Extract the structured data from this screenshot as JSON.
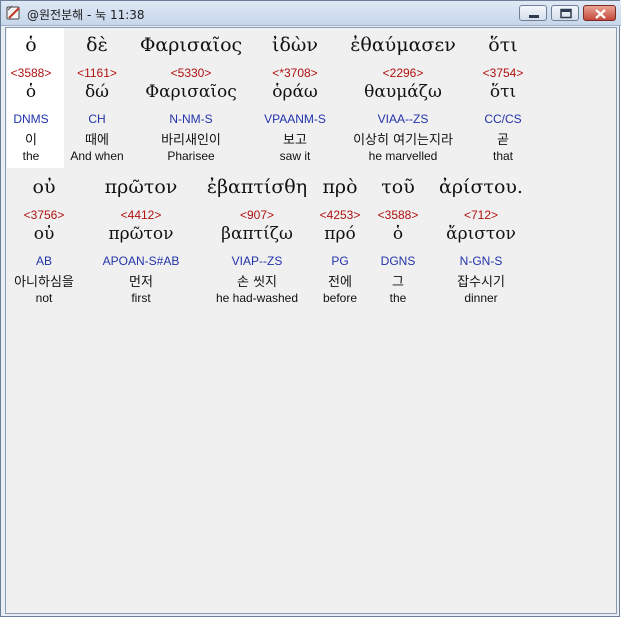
{
  "window": {
    "title": "@원전분해 - 눅 11:38"
  },
  "rows": [
    {
      "words": [
        {
          "greek": "ὁ",
          "strong": "<3588>",
          "lemma": "ὁ",
          "morph": "DNMS",
          "korean": "이",
          "english": "the"
        },
        {
          "greek": "δὲ",
          "strong": "<1161>",
          "lemma": "δώ",
          "morph": "CH",
          "korean": "때에",
          "english": "And when"
        },
        {
          "greek": "Φαρισαῖος",
          "strong": "<5330>",
          "lemma": "Φαρισαῖος",
          "morph": "N-NM-S",
          "korean": "바리새인이",
          "english": "Pharisee"
        },
        {
          "greek": "ἰδὼν",
          "strong": "<*3708>",
          "lemma": "ὁράω",
          "morph": "VPAANM-S",
          "korean": "보고",
          "english": "saw it"
        },
        {
          "greek": "ἐθαύμασεν",
          "strong": "<2296>",
          "lemma": "θαυμάζω",
          "morph": "VIAA--ZS",
          "korean": "이상히 여기는지라",
          "english": "he marvelled"
        },
        {
          "greek": "ὅτι",
          "strong": "<3754>",
          "lemma": "ὅτι",
          "morph": "CC/CS",
          "korean": "곧",
          "english": "that"
        }
      ]
    },
    {
      "words": [
        {
          "greek": "οὐ",
          "strong": "<3756>",
          "lemma": "οὐ",
          "morph": "AB",
          "korean": "아니하심을",
          "english": "not"
        },
        {
          "greek": "πρῶτον",
          "strong": "<4412>",
          "lemma": "πρῶτον",
          "morph": "APOAN-S#AB",
          "korean": "먼저",
          "english": "first"
        },
        {
          "greek": "ἐβαπτίσθη",
          "strong": "<907>",
          "lemma": "βαπτίζω",
          "morph": "VIAP--ZS",
          "korean": "손 씻지",
          "english": "he had-washed"
        },
        {
          "greek": "πρὸ",
          "strong": "<4253>",
          "lemma": "πρό",
          "morph": "PG",
          "korean": "전에",
          "english": "before"
        },
        {
          "greek": "τοῦ",
          "strong": "<3588>",
          "lemma": "ὁ",
          "morph": "DGNS",
          "korean": "그",
          "english": "the"
        },
        {
          "greek": "ἀρίστου.",
          "strong": "<712>",
          "lemma": "ἄριστον",
          "morph": "N-GN-S",
          "korean": "잡수시기",
          "english": "dinner"
        }
      ]
    }
  ],
  "colors": {
    "strong": "#b01010",
    "morph": "#2233aa",
    "highlight": "#ffffff",
    "client_bg": "#f0f0f0"
  },
  "icons": {
    "app": "bible-app-icon",
    "minimize": "minimize-icon",
    "maximize": "maximize-icon",
    "close": "close-icon"
  }
}
